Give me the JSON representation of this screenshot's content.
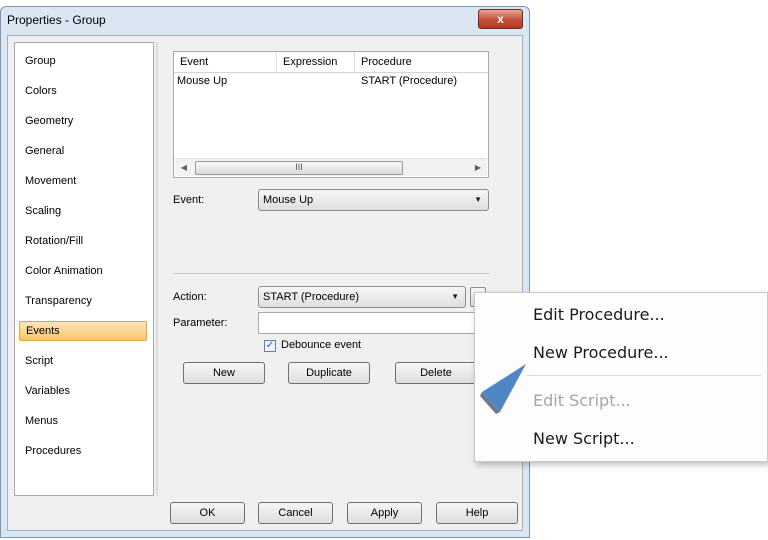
{
  "window": {
    "title": "Properties - Group",
    "close_glyph": "x"
  },
  "nav": {
    "items": [
      {
        "label": "Group"
      },
      {
        "label": "Colors"
      },
      {
        "label": "Geometry"
      },
      {
        "label": "General"
      },
      {
        "label": "Movement"
      },
      {
        "label": "Scaling"
      },
      {
        "label": "Rotation/Fill"
      },
      {
        "label": "Color Animation"
      },
      {
        "label": "Transparency"
      },
      {
        "label": "Events",
        "selected": true
      },
      {
        "label": "Script"
      },
      {
        "label": "Variables"
      },
      {
        "label": "Menus"
      },
      {
        "label": "Procedures"
      }
    ]
  },
  "events_table": {
    "columns": [
      "Event",
      "Expression",
      "Procedure"
    ],
    "rows": [
      {
        "event": "Mouse Up",
        "expression": "",
        "procedure": "START (Procedure)"
      }
    ],
    "scroll_left_icon": "chevron-left-icon",
    "scroll_right_icon": "chevron-right-icon",
    "scroll_grip": "III"
  },
  "form": {
    "event_label": "Event:",
    "event_value": "Mouse Up",
    "action_label": "Action:",
    "action_value": "START (Procedure)",
    "action_more_glyph": ">",
    "parameter_label": "Parameter:",
    "parameter_value": "",
    "debounce_label": "Debounce event",
    "debounce_checked": true
  },
  "buttons": {
    "new": "New",
    "duplicate": "Duplicate",
    "delete": "Delete"
  },
  "footer": {
    "ok": "OK",
    "cancel": "Cancel",
    "apply": "Apply",
    "help": "Help"
  },
  "context_menu": {
    "items": [
      {
        "label": "Edit Procedure...",
        "enabled": true
      },
      {
        "label": "New Procedure...",
        "enabled": true
      },
      {
        "label": "Edit Script...",
        "enabled": false
      },
      {
        "label": "New Script...",
        "enabled": true
      }
    ]
  },
  "colors": {
    "selection": "#f8c66a",
    "close_button": "#c4513a",
    "pointer": "#4f86c6"
  }
}
